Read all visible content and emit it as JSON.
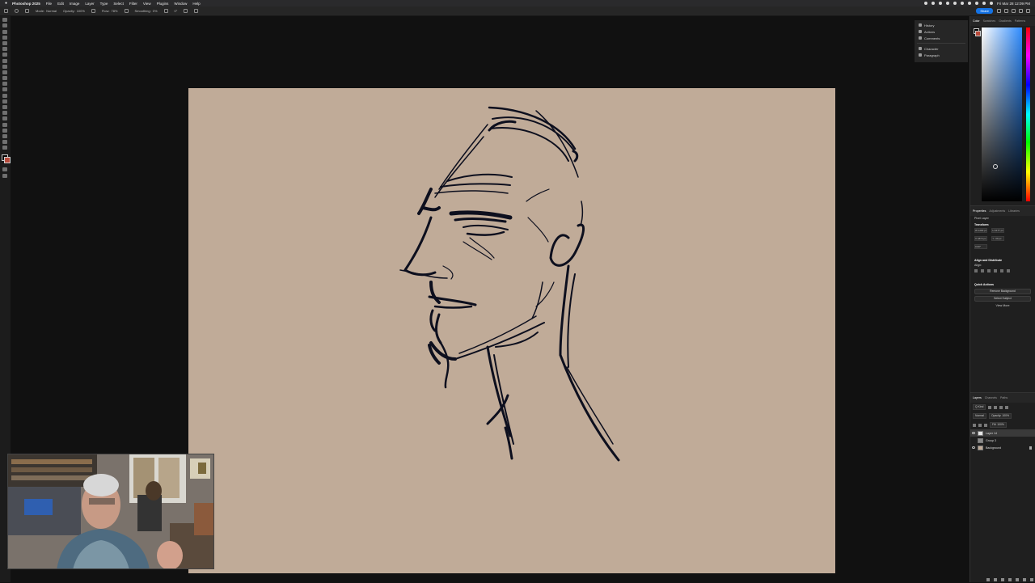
{
  "menubar": {
    "apple": "",
    "app": "Photoshop 2025",
    "items": [
      "File",
      "Edit",
      "Image",
      "Layer",
      "Type",
      "Select",
      "Filter",
      "View",
      "Plugins",
      "Window",
      "Help"
    ],
    "clock": "Fri Mar 28  12:09 PM"
  },
  "options": {
    "mode_label": "Mode:",
    "mode_value": "Normal",
    "opacity_label": "Opacity:",
    "opacity_value": "100%",
    "flow_label": "Flow:",
    "flow_value": "78%",
    "smoothing_label": "Smoothing:",
    "smoothing_value": "0%",
    "angle_value": "0°",
    "share_label": "Share"
  },
  "floatpanel": {
    "items": [
      "History",
      "Actions",
      "Comments",
      "Character",
      "Paragraph"
    ]
  },
  "color_panel": {
    "tabs": [
      "Color",
      "Swatches",
      "Gradients",
      "Patterns"
    ],
    "foreground": "#000000",
    "background": "#b84a3b"
  },
  "properties_panel": {
    "tabs": [
      "Properties",
      "Adjustments",
      "Libraries"
    ],
    "layer_type": "Pixel Layer",
    "transform_heading": "Transform",
    "w": "W  1200 px",
    "h": "H  1177 px",
    "x": "X  1872 px",
    "y": "Y  -30 px",
    "angle": "0.00°",
    "align_heading": "Align and Distribute",
    "align_sub": "Align:",
    "quick_heading": "Quick Actions",
    "remove_bg": "Remove Background",
    "select_subject": "Select Subject",
    "view_more": "View More"
  },
  "layers_panel": {
    "tabs": [
      "Layers",
      "Channels",
      "Paths"
    ],
    "kind": "Q Kind",
    "blend": "Normal",
    "opacity": "Opacity: 100%",
    "fill": "Fill: 100%",
    "layers": [
      {
        "name": "Layer 14",
        "selected": true
      },
      {
        "name": "Group 3",
        "selected": false
      },
      {
        "name": "Background",
        "selected": false
      }
    ]
  },
  "canvas": {
    "color": "#c0ab98",
    "ink": "#0d0f1e"
  }
}
